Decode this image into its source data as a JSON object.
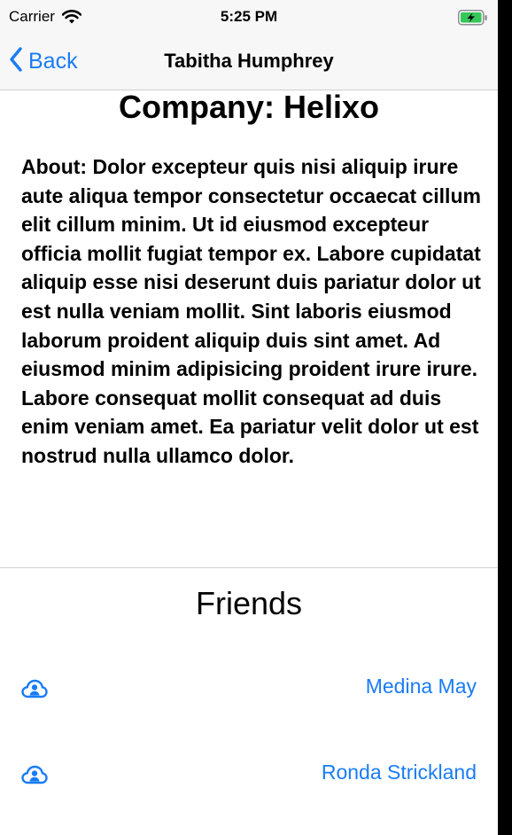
{
  "status_bar": {
    "carrier": "Carrier",
    "time": "5:25 PM",
    "wifi_icon": "wifi-icon",
    "battery_icon": "battery-charging-icon"
  },
  "nav": {
    "back_label": "Back",
    "back_icon": "chevron-left-icon",
    "title": "Tabitha Humphrey"
  },
  "profile": {
    "company": "Company: Helixo",
    "about": "About: Dolor excepteur quis nisi aliquip irure aute aliqua tempor consectetur occaecat cillum elit cillum minim. Ut id eiusmod excepteur officia mollit fugiat tempor ex. Labore cupidatat aliquip esse nisi deserunt duis pariatur dolor ut est nulla veniam mollit. Sint laboris eiusmod laborum proident aliquip duis sint amet. Ad eiusmod minim adipisicing proident irure irure. Labore consequat mollit consequat ad duis enim veniam amet. Ea pariatur velit dolor ut est nostrud nulla ullamco dolor."
  },
  "friends": {
    "title": "Friends",
    "items": [
      {
        "name": "Medina May",
        "icon": "cloud-person-icon"
      },
      {
        "name": "Ronda Strickland",
        "icon": "cloud-person-icon"
      }
    ]
  },
  "colors": {
    "accent": "#1a7cf5",
    "bar_background": "#f7f7f7",
    "battery_fill": "#34c759"
  }
}
